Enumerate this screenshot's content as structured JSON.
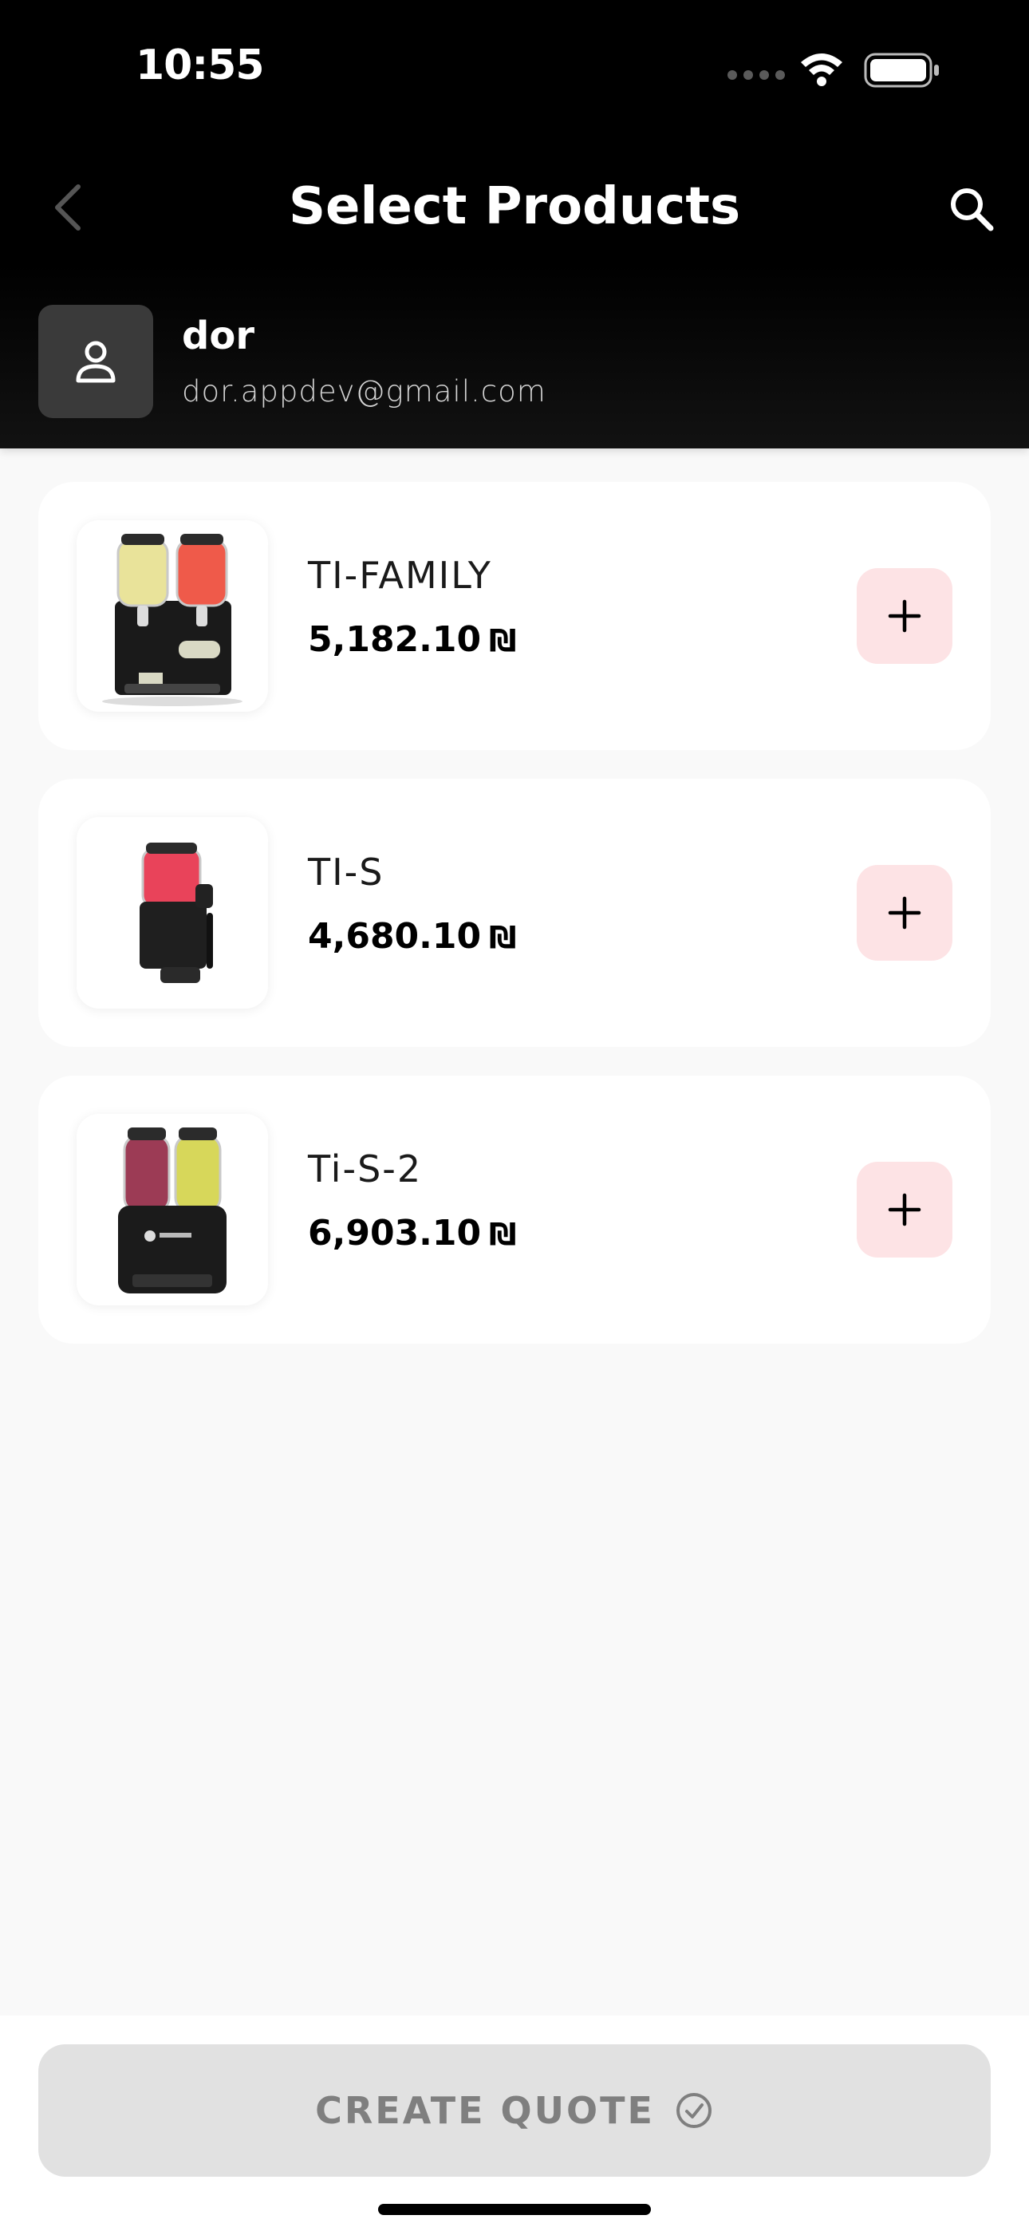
{
  "status_bar": {
    "time": "10:55"
  },
  "header": {
    "title": "Select Products"
  },
  "customer": {
    "name": "dor",
    "email": "dor.appdev@gmail.com"
  },
  "products": [
    {
      "name": "TI-FAMILY",
      "price": "5,182.10",
      "currency": "₪",
      "image": "double-bowl-slush-machine"
    },
    {
      "name": "TI-S",
      "price": "4,680.10",
      "currency": "₪",
      "image": "single-bowl-slush-machine"
    },
    {
      "name": "Ti-S-2",
      "price": "6,903.10",
      "currency": "₪",
      "image": "double-bowl-slush-machine"
    }
  ],
  "footer": {
    "create_quote_label": "CREATE QUOTE"
  },
  "colors": {
    "accent_soft": "#fde3e5",
    "header_bg": "#000000",
    "disabled_button": "#e1e1e1"
  }
}
